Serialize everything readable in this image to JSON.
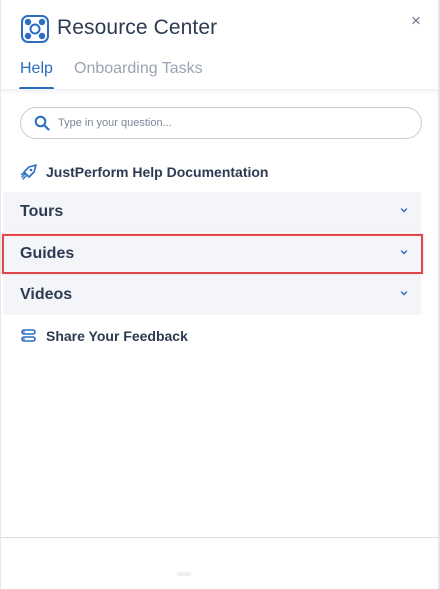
{
  "header": {
    "logo_icon": "lifebuoy-logo-icon",
    "title": "Resource Center",
    "close_icon": "close-icon",
    "close_glyph": "×"
  },
  "tabs": [
    {
      "label": "Help",
      "active": true
    },
    {
      "label": "Onboarding Tasks",
      "active": false
    }
  ],
  "search": {
    "placeholder": "Type in your question...",
    "value": "",
    "icon": "search-icon"
  },
  "items": {
    "documentation": {
      "label": "JustPerform Help Documentation",
      "icon": "rocket-icon"
    },
    "tours": {
      "label": "Tours",
      "icon": "chevron-down-icon"
    },
    "guides": {
      "label": "Guides",
      "icon": "chevron-down-icon",
      "highlighted": true
    },
    "videos": {
      "label": "Videos",
      "icon": "chevron-down-icon"
    },
    "feedback": {
      "label": "Share Your Feedback",
      "icon": "feedback-icon"
    }
  },
  "colors": {
    "accent": "#2a6dc2",
    "text": "#2d3b52",
    "muted": "#9aa3b3",
    "accordion_bg": "#f3f5f8",
    "highlight": "#e0484c"
  }
}
